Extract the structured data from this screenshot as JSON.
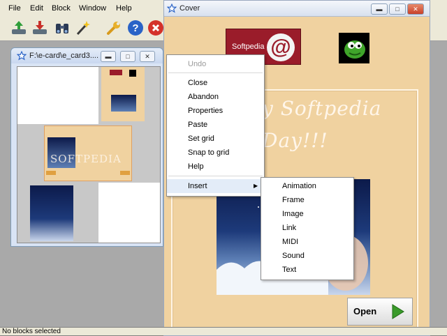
{
  "menubar": {
    "items": [
      "File",
      "Edit",
      "Block",
      "Window",
      "Help"
    ]
  },
  "toolbar": {
    "icons": [
      "import-icon",
      "export-icon",
      "binoculars-icon",
      "magic-wand-icon",
      "wrench-icon",
      "help-icon",
      "close-icon"
    ]
  },
  "child_window": {
    "title": "F:\\e-card\\e_card3....",
    "thumb_watermark": "SOFTPEDIA"
  },
  "cover_window": {
    "title": "Cover",
    "logo_text": "Softpedia",
    "logo_symbol": "@",
    "greeting_line1": "y Softpedia",
    "greeting_line2": "Day!!!",
    "open_label": "Open"
  },
  "context_menu": {
    "items": [
      "Undo",
      "Close",
      "Abandon",
      "Properties",
      "Paste",
      "Set grid",
      "Snap to grid",
      "Help",
      "Insert"
    ]
  },
  "insert_submenu": {
    "items": [
      "Animation",
      "Frame",
      "Image",
      "Link",
      "MIDI",
      "Sound",
      "Text"
    ]
  },
  "status": {
    "text": "No blocks selected"
  },
  "colors": {
    "card_background": "#f0d2a0",
    "logo_red": "#9a1c2a",
    "menu_highlight": "#e3ecf8"
  }
}
